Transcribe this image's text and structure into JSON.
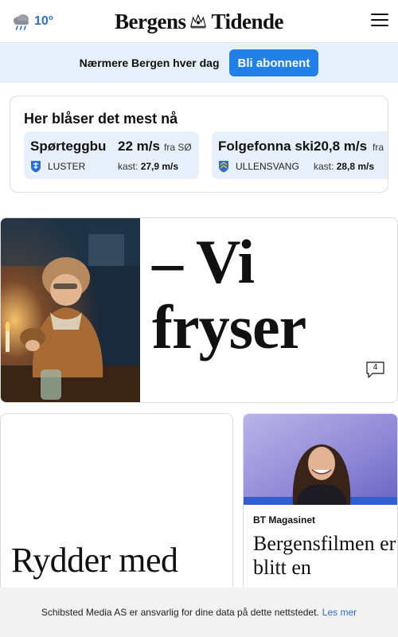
{
  "header": {
    "temperature": "10°",
    "weather_icon": "cloud-rain-icon",
    "logo_left": "Bergens",
    "logo_right": "Tidende",
    "menu_icon": "hamburger-menu-icon"
  },
  "subscribe": {
    "text": "Nærmere Bergen hver dag",
    "button": "Bli abonnent"
  },
  "wind": {
    "title": "Her blåser det mest nå",
    "items": [
      {
        "location": "Spørteggbu",
        "speed": "22 m/s",
        "direction": "fra SØ",
        "municipality": "LUSTER",
        "gust_label": "kast:",
        "gust": "27,9 m/s"
      },
      {
        "location": "Folgefonna ski",
        "speed": "20,8 m/s",
        "direction": "fra",
        "municipality": "ULLENSVANG",
        "gust_label": "kast:",
        "gust": "28,8 m/s"
      }
    ]
  },
  "main_story": {
    "headline_line1": "– Vi",
    "headline_line2": "fryser",
    "comments": "4"
  },
  "story_left": {
    "headline": "Rydder med"
  },
  "story_right": {
    "kicker": "BT Magasinet",
    "headline": "Bergensfilmen er blitt en"
  },
  "consent": {
    "text": "Schibsted Media AS er ansvarlig for dine data på dette nettstedet.",
    "link": "Les mer"
  },
  "colors": {
    "accent": "#2280e8",
    "banner_bg": "#e6f0fb",
    "wind_item_bg": "#e8f1fb"
  }
}
